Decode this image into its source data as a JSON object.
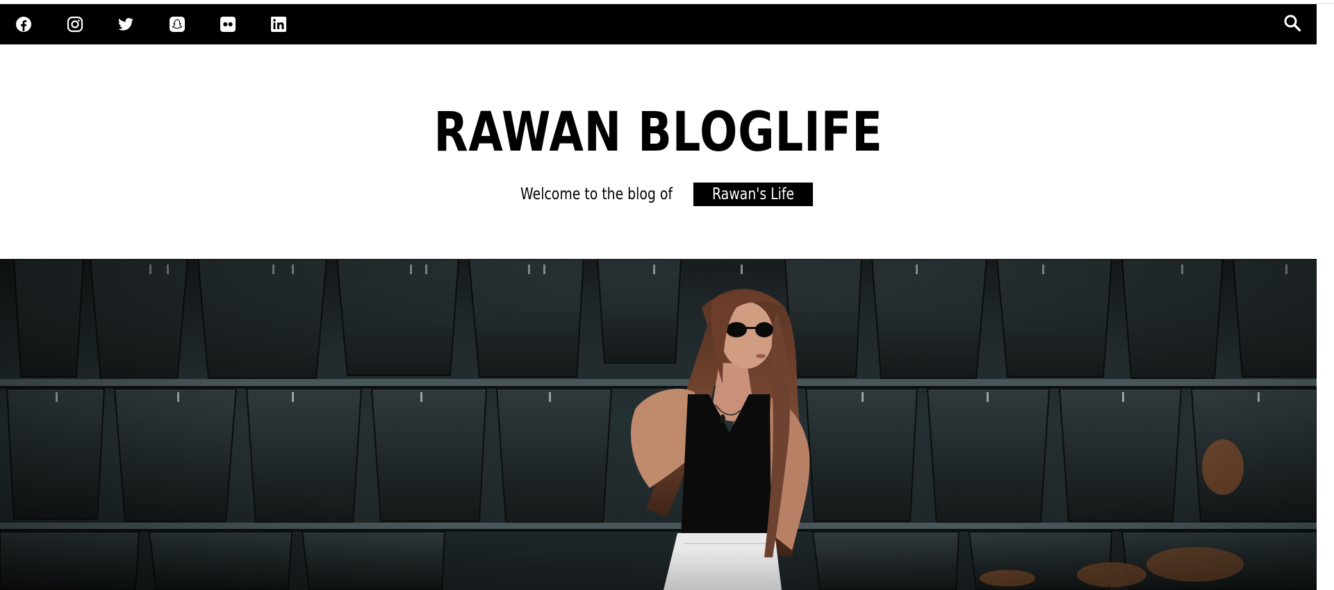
{
  "header": {
    "social_links": [
      {
        "name": "facebook",
        "icon": "facebook-icon"
      },
      {
        "name": "instagram",
        "icon": "instagram-icon"
      },
      {
        "name": "twitter",
        "icon": "twitter-icon"
      },
      {
        "name": "snapchat",
        "icon": "snapchat-icon"
      },
      {
        "name": "flickr",
        "icon": "flickr-icon"
      },
      {
        "name": "linkedin",
        "icon": "linkedin-icon"
      }
    ],
    "search_icon": "search-icon",
    "bar_color": "#000000"
  },
  "branding": {
    "site_title": "RAWAN BLOGLIFE",
    "tagline_prefix": "Welcome to the blog of",
    "tagline_highlight": "Rawan's Life"
  },
  "hero": {
    "image_icon": "hero-photo"
  }
}
